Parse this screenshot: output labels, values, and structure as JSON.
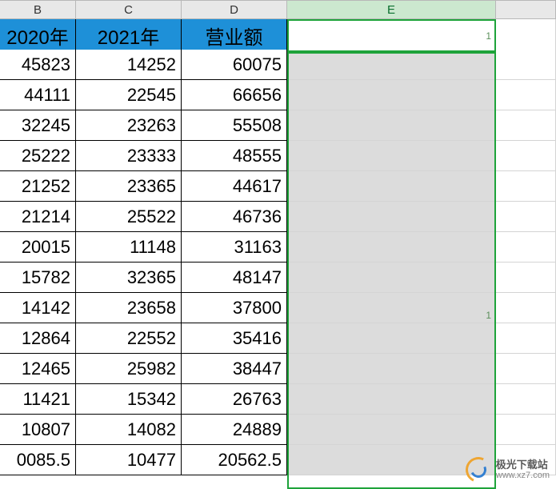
{
  "columns": {
    "b": "B",
    "c": "C",
    "d": "D",
    "e": "E"
  },
  "headers": {
    "b": "2020年",
    "c": "2021年",
    "d": "营业额"
  },
  "rows": [
    {
      "b": "45823",
      "c": "14252",
      "d": "60075"
    },
    {
      "b": "44111",
      "c": "22545",
      "d": "66656"
    },
    {
      "b": "32245",
      "c": "23263",
      "d": "55508"
    },
    {
      "b": "25222",
      "c": "23333",
      "d": "48555"
    },
    {
      "b": "21252",
      "c": "23365",
      "d": "44617"
    },
    {
      "b": "21214",
      "c": "25522",
      "d": "46736"
    },
    {
      "b": "20015",
      "c": "11148",
      "d": "31163"
    },
    {
      "b": "15782",
      "c": "32365",
      "d": "48147"
    },
    {
      "b": "14142",
      "c": "23658",
      "d": "37800"
    },
    {
      "b": "12864",
      "c": "22552",
      "d": "35416"
    },
    {
      "b": "12465",
      "c": "25982",
      "d": "38447"
    },
    {
      "b": "11421",
      "c": "15342",
      "d": "26763"
    },
    {
      "b": "10807",
      "c": "14082",
      "d": "24889"
    },
    {
      "b": "0085.5",
      "c": "10477",
      "d": "20562.5"
    }
  ],
  "active_cell": {
    "indicator": "1"
  },
  "selection": {
    "tag": "1"
  },
  "watermark": {
    "cn": "极光下载站",
    "url": "www.xz7.com"
  }
}
